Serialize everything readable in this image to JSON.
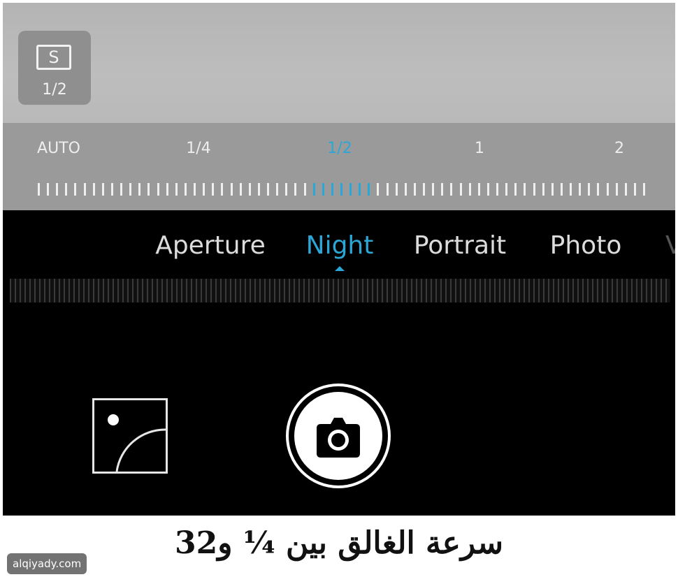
{
  "camera": {
    "mode_badge": {
      "icon_letter": "S",
      "value": "1/2"
    },
    "shutter_scale": {
      "labels": [
        "AUTO",
        "1/4",
        "1/2",
        "1",
        "2"
      ],
      "selected": "1/2"
    },
    "modes": {
      "items": [
        "Aperture",
        "Night",
        "Portrait",
        "Photo"
      ],
      "active": "Night",
      "overflow_glyph": "V"
    },
    "gallery_icon": "gallery-thumbnail-icon",
    "shutter_icon": "camera-icon",
    "colors": {
      "accent": "#2aa7d6",
      "background": "#000000"
    }
  },
  "caption": "سرعة الغالق بين ¼ و32",
  "watermark": "alqiyady.com"
}
